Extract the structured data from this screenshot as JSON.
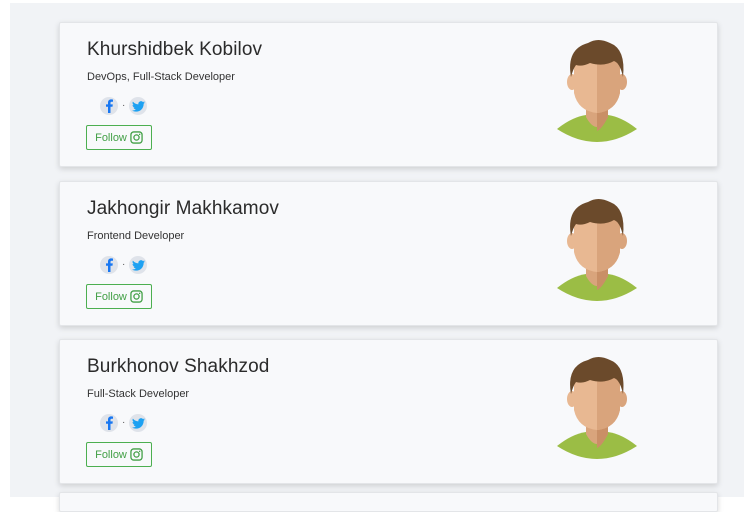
{
  "profiles": [
    {
      "name": "Khurshidbek Kobilov",
      "role": "DevOps, Full-Stack Developer",
      "separator": "·",
      "follow_label": "Follow"
    },
    {
      "name": "Jakhongir Makhkamov",
      "role": "Frontend Developer",
      "separator": "·",
      "follow_label": "Follow"
    },
    {
      "name": "Burkhonov Shakhzod",
      "role": "Full-Stack Developer",
      "separator": "·",
      "follow_label": "Follow"
    }
  ],
  "icons": {
    "facebook": "facebook-icon",
    "twitter": "twitter-icon",
    "instagram": "instagram-icon",
    "avatar": "male-avatar"
  },
  "colors": {
    "facebook": "#1877f2",
    "twitter": "#1da1f2",
    "follow": "#43a047",
    "shirt": "#9bbd45",
    "hair": "#6b4a2b",
    "skin": "#e8b892"
  }
}
